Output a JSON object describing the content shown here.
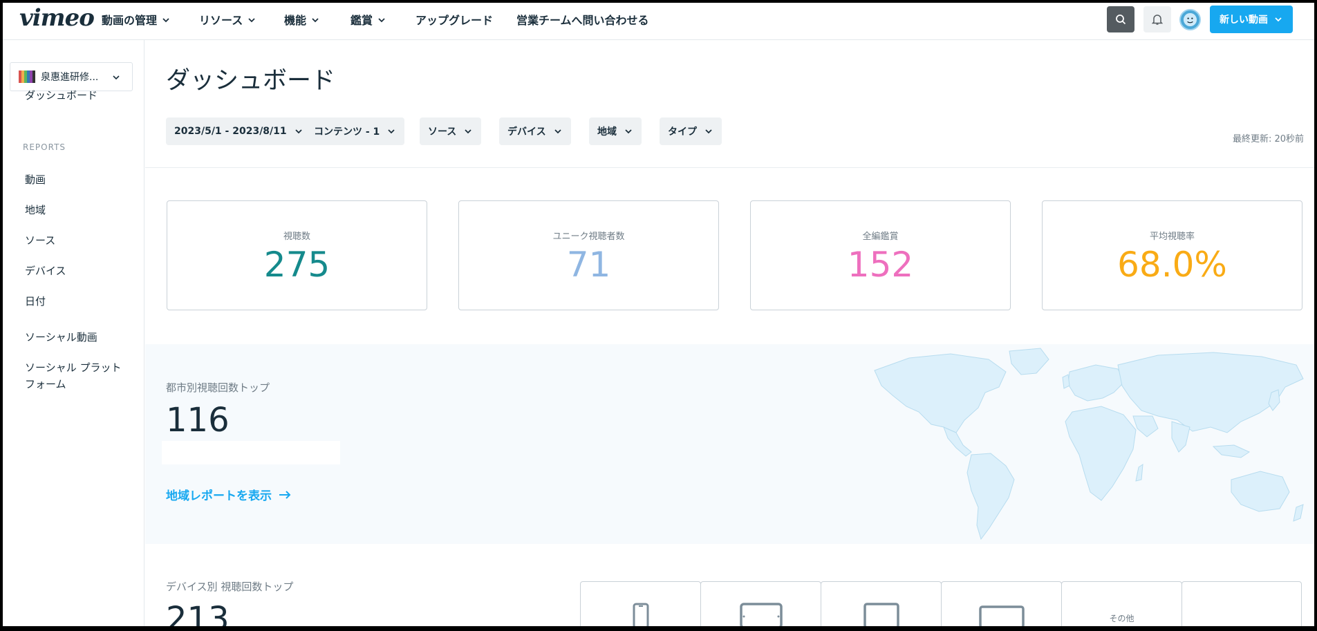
{
  "nav": {
    "logo": "vimeo",
    "items": [
      {
        "label": "動画の管理",
        "dropdown": true
      },
      {
        "label": "リソース",
        "dropdown": true
      },
      {
        "label": "機能",
        "dropdown": true
      },
      {
        "label": "鑑賞",
        "dropdown": true
      },
      {
        "label": "アップグレード",
        "dropdown": false
      },
      {
        "label": "営業チームへ問い合わせる",
        "dropdown": false
      }
    ],
    "new_video_label": "新しい動画",
    "icons": [
      "search-icon",
      "bell-icon",
      "avatar-icon",
      "chevron-down-icon"
    ]
  },
  "sidebar": {
    "team_name": "泉惠進研修...",
    "team_logo_colors": [
      "#d9534f",
      "#f0ad4e",
      "#5cb85c",
      "#337ab7",
      "#8e44ad",
      "#333333"
    ],
    "dashboard_label": "ダッシュボード",
    "section_label": "REPORTS",
    "reports": [
      "動画",
      "地域",
      "ソース",
      "デバイス",
      "日付"
    ],
    "social": [
      "ソーシャル動画",
      "ソーシャル プラット",
      "フォーム"
    ]
  },
  "main": {
    "title": "ダッシュボード",
    "filters": [
      "2023/5/1 - 2023/8/11",
      "コンテンツ - 1",
      "ソース",
      "デバイス",
      "地域",
      "タイプ"
    ],
    "last_updated": "最終更新: 20秒前",
    "stats": [
      {
        "label": "視聴数",
        "value": "275",
        "color": "#158a8c"
      },
      {
        "label": "ユニーク視聴者数",
        "value": "71",
        "color": "#8fb6e2"
      },
      {
        "label": "全編鑑賞",
        "value": "152",
        "color": "#ee6fbe"
      },
      {
        "label": "平均視聴率",
        "value": "68.0%",
        "color": "#f9ab15"
      }
    ],
    "geo": {
      "label": "都市別視聴回数トップ",
      "value": "116",
      "link_label": "地域レポートを表示",
      "map_color": "#dcf0fb"
    },
    "devices": {
      "label": "デバイス別 視聴回数トップ",
      "value": "213",
      "cards": [
        "phone-icon",
        "tablet-landscape-icon",
        "tablet-icon",
        "monitor-icon",
        "other",
        "empty"
      ],
      "other_text": "その他"
    }
  },
  "colors": {
    "accent": "#17a8f0",
    "text": "#1a2e3b",
    "muted": "#6f7c86"
  }
}
